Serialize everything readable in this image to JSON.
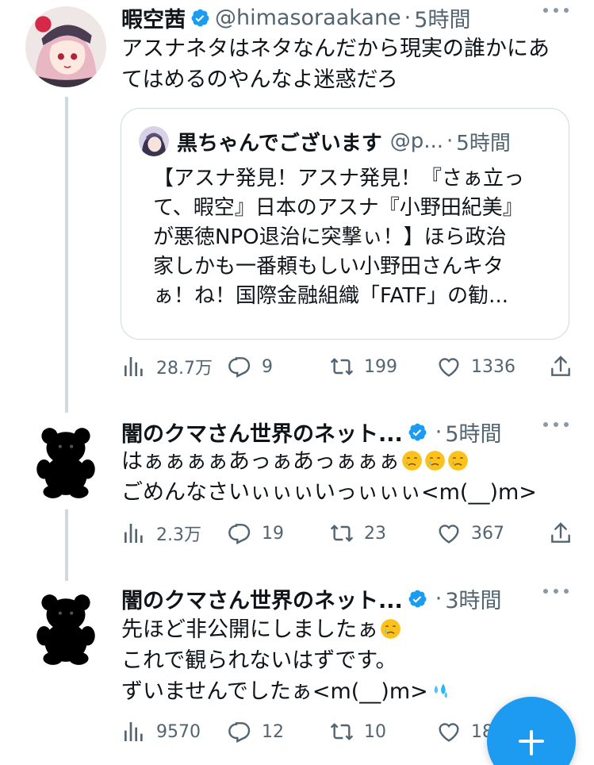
{
  "colors": {
    "accent": "#1d9bf0",
    "secondary_text": "#536471",
    "border": "#cfd9de"
  },
  "tweets": [
    {
      "name": "暇空茜",
      "handle": "@himasoraakane",
      "separator": "·",
      "time": "5時間",
      "text_lines": [
        "アスナネタはネタなんだから現実の誰かにあ",
        "てはめるのやんなよ迷惑だろ"
      ],
      "avatar_icon": "anime-avatar-icon",
      "quote": {
        "name": "黒ちゃんでございます",
        "handle": "@p...",
        "separator": "·",
        "time": "5時間",
        "text_lines": [
          "【アスナ発見！アスナ発見！『さぁ立っ",
          "て、暇空』日本のアスナ『小野田紀美』",
          "が悪徳NPO退治に突撃ぃ！】ほら政治",
          "家しかも一番頼もしい小野田さんキタ",
          "ぁ！ね！国際金融組織「FATF」の勧..."
        ]
      },
      "stats": {
        "views": "28.7万",
        "replies": "9",
        "retweets": "199",
        "likes": "1336"
      }
    },
    {
      "name": "闇のクマさん世界のネット...",
      "separator": "·",
      "time": "5時間",
      "text_lines": [
        "はぁぁぁぁあっぁあっぁぁぁ",
        "ごめんなさいぃぃぃいっぃぃぃ<m(__)m>"
      ],
      "avatar_icon": "black-bear-icon",
      "stats": {
        "views": "2.3万",
        "replies": "19",
        "retweets": "23",
        "likes": "367"
      }
    },
    {
      "name": "闇のクマさん世界のネット...",
      "separator": "·",
      "time": "3時間",
      "text_lines": [
        "先ほど非公開にしましたぁ",
        "これで観られないはずです。",
        "ずいませんでしたぁ<m(__)m>"
      ],
      "avatar_icon": "black-bear-icon",
      "stats": {
        "views": "9570",
        "replies": "12",
        "retweets": "10",
        "likes": "18"
      }
    }
  ],
  "fab": {
    "icon": "plus-icon"
  }
}
